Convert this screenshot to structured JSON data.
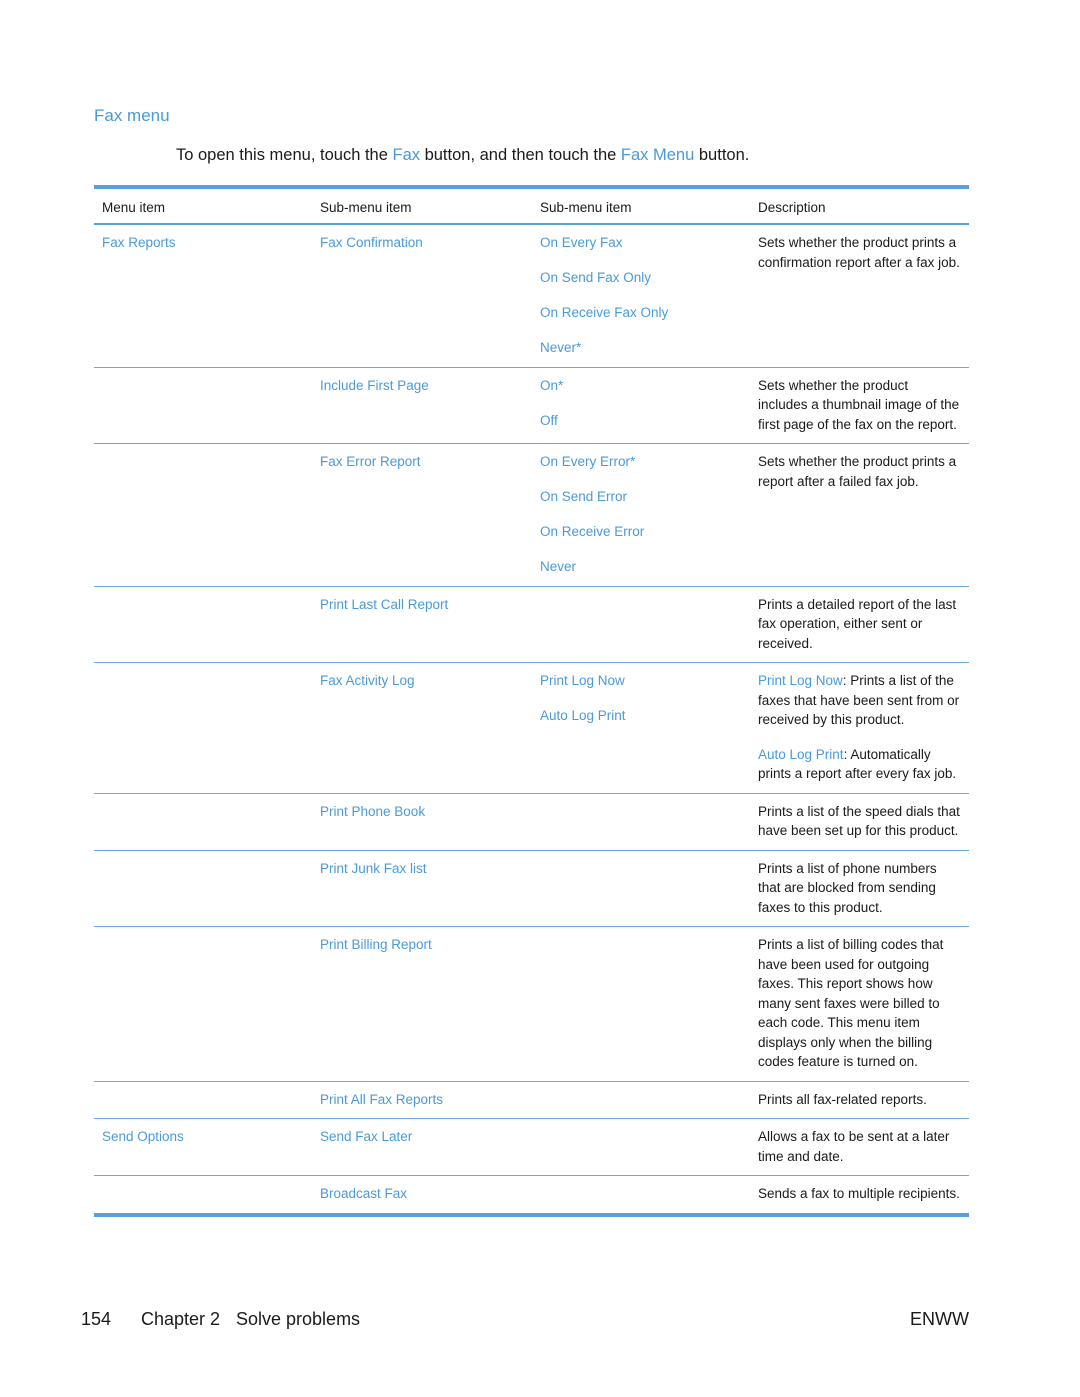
{
  "section": {
    "title": "Fax menu"
  },
  "intro": {
    "part1": "To open this menu, touch the ",
    "link1": "Fax",
    "part2": " button, and then touch the ",
    "link2": "Fax Menu",
    "part3": " button."
  },
  "table": {
    "headers": [
      "Menu item",
      "Sub-menu item",
      "Sub-menu item",
      "Description"
    ],
    "rows": [
      {
        "menu_item": "Fax Reports",
        "sub_item": "Fax Confirmation",
        "options": [
          "On Every Fax",
          "On Send Fax Only",
          "On Receive Fax Only",
          "Never*"
        ],
        "description": [
          "Sets whether the product prints a confirmation report after a fax job."
        ]
      },
      {
        "menu_item": "",
        "sub_item": "Include First Page",
        "options": [
          "On*",
          "Off"
        ],
        "description": [
          "Sets whether the product includes a thumbnail image of the first page of the fax on the report."
        ]
      },
      {
        "menu_item": "",
        "sub_item": "Fax Error Report",
        "options": [
          "On Every Error*",
          "On Send Error",
          "On Receive Error",
          "Never"
        ],
        "description": [
          "Sets whether the product prints a report after a failed fax job."
        ]
      },
      {
        "menu_item": "",
        "sub_item": "Print Last Call Report",
        "options": [],
        "description": [
          "Prints a detailed report of the last fax operation, either sent or received."
        ]
      },
      {
        "menu_item": "",
        "sub_item": "Fax Activity Log",
        "options": [
          "Print Log Now",
          "Auto Log Print"
        ],
        "description_parts": [
          {
            "link": "Print Log Now",
            "text": ": Prints a list of the faxes that have been sent from or received by this product."
          },
          {
            "link": "Auto Log Print",
            "text": ": Automatically prints a report after every fax job."
          }
        ]
      },
      {
        "menu_item": "",
        "sub_item": "Print Phone Book",
        "options": [],
        "description": [
          "Prints a list of the speed dials that have been set up for this product."
        ]
      },
      {
        "menu_item": "",
        "sub_item": "Print Junk Fax list",
        "options": [],
        "description": [
          "Prints a list of phone numbers that are blocked from sending faxes to this product."
        ]
      },
      {
        "menu_item": "",
        "sub_item": "Print Billing Report",
        "options": [],
        "description": [
          "Prints a list of billing codes that have been used for outgoing faxes. This report shows how many sent faxes were billed to each code. This menu item displays only when the billing codes feature is turned on."
        ]
      },
      {
        "menu_item": "",
        "sub_item": "Print All Fax Reports",
        "options": [],
        "description": [
          "Prints all fax-related reports."
        ]
      },
      {
        "menu_item": "Send Options",
        "sub_item": "Send Fax Later",
        "options": [],
        "description": [
          "Allows a fax to be sent at a later time and date."
        ]
      },
      {
        "menu_item": "",
        "sub_item": "Broadcast Fax",
        "options": [],
        "description": [
          "Sends a fax to multiple recipients."
        ]
      }
    ]
  },
  "footer": {
    "page_number": "154",
    "chapter": "Chapter 2",
    "chapter_title": "Solve problems",
    "locale": "ENWW"
  },
  "colors": {
    "accent": "#4a9ad8",
    "rule": "#5b9fd9",
    "text": "#1a1a1a"
  }
}
